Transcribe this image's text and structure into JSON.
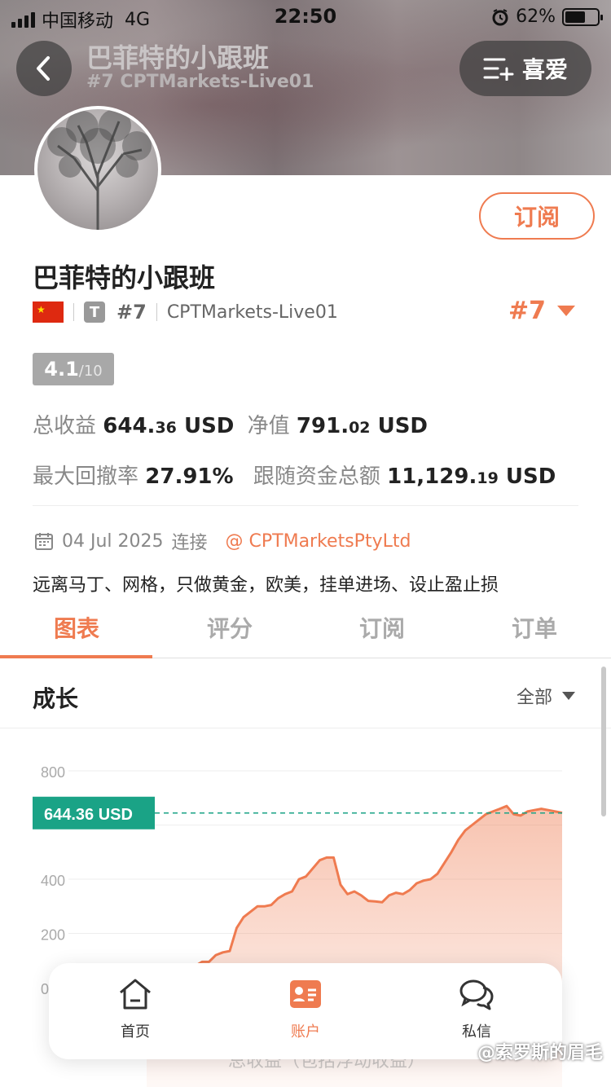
{
  "status_bar": {
    "carrier": "中国移动",
    "network": "4G",
    "time": "22:50",
    "battery": "62%",
    "battery_level": 0.62
  },
  "header": {
    "title": "巴菲特的小跟班",
    "subtitle": "#7 CPTMarkets-Live01",
    "favorite_label": "喜爱"
  },
  "profile": {
    "subscribe_label": "订阅",
    "name": "巴菲特的小跟班",
    "account_type_badge": "T",
    "rank": "#7",
    "server": "CPTMarkets-Live01",
    "rank_right": "#7",
    "score": "4.1",
    "score_max": "/10"
  },
  "stats": {
    "total_profit_label": "总收益",
    "total_profit_int": "644.",
    "total_profit_dec": "36",
    "total_profit_unit": "USD",
    "equity_label": "净值",
    "equity_int": "791.",
    "equity_dec": "02",
    "equity_unit": "USD",
    "max_drawdown_label": "最大回撤率",
    "max_drawdown": "27.91%",
    "follow_funds_label": "跟随资金总额",
    "follow_funds_int": "11,129.",
    "follow_funds_dec": "19",
    "follow_funds_unit": "USD"
  },
  "connection": {
    "date": "04 Jul 2025",
    "date_suffix": "连接",
    "broker": "@ CPTMarketsPtyLtd"
  },
  "description": "远离马丁、网格，只做黄金，欧美，挂单进场、设止盈止损",
  "tabs": [
    {
      "label": "图表",
      "active": true
    },
    {
      "label": "评分",
      "active": false
    },
    {
      "label": "订阅",
      "active": false
    },
    {
      "label": "订单",
      "active": false
    }
  ],
  "growth": {
    "title": "成长",
    "filter": "全部"
  },
  "chart_data": {
    "type": "area",
    "y_ticks": [
      "800",
      "",
      "400",
      "200",
      "0"
    ],
    "ylim": [
      0,
      800
    ],
    "current_value_label": "644.36 USD",
    "current_value": 644.36,
    "accent_color": "#ef7b50",
    "marker_color": "#1aa386",
    "x_label_partial": "总收益（包括浮动收益）",
    "series": [
      {
        "values": [
          0,
          2,
          5,
          10,
          40,
          60,
          65,
          80,
          95,
          95,
          120,
          130,
          135,
          220,
          260,
          280,
          300,
          300,
          305,
          330,
          345,
          355,
          400,
          410,
          440,
          470,
          480,
          480,
          380,
          345,
          355,
          340,
          320,
          318,
          315,
          340,
          350,
          345,
          360,
          385,
          395,
          400,
          420,
          460,
          500,
          545,
          580,
          600,
          620,
          640,
          650,
          660,
          670,
          640,
          635,
          650,
          655,
          660,
          655,
          650,
          645
        ]
      }
    ]
  },
  "bottom_nav": [
    {
      "label": "首页",
      "icon": "home-icon",
      "active": false
    },
    {
      "label": "账户",
      "icon": "account-card-icon",
      "active": true
    },
    {
      "label": "私信",
      "icon": "chat-bubbles-icon",
      "active": false
    }
  ],
  "watermark": "@索罗斯的眉毛"
}
